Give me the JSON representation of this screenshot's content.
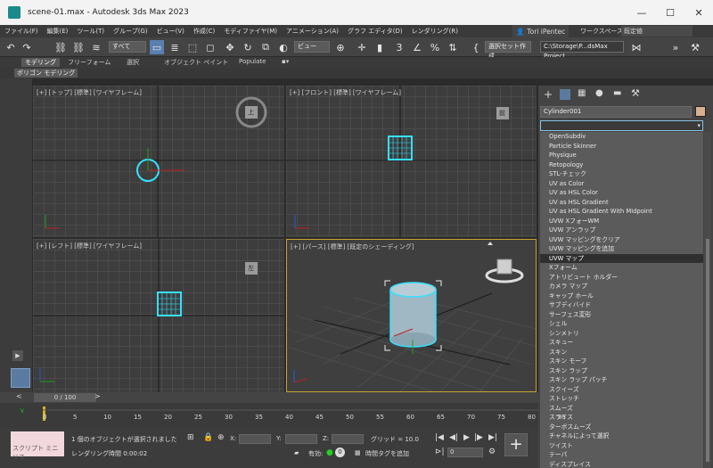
{
  "window": {
    "title": "scene-01.max - Autodesk 3ds Max 2023",
    "minimize_icon": "—",
    "maximize_icon": "☐",
    "close_icon": "✕"
  },
  "menu": {
    "items": [
      "ファイル(F)",
      "編集(E)",
      "ツール(T)",
      "グループ(G)",
      "ビュー(V)",
      "作成(C)",
      "モディファイヤ(M)",
      "アニメーション(A)",
      "グラフ エディタ(D)",
      "レンダリング(R)"
    ],
    "user": "Tori iPentec",
    "workspace_label": "ワークスペース:",
    "workspace_value": "既定値"
  },
  "toolbar": {
    "selection_filter": "すべて",
    "ref_coord": "ビュー",
    "named_selection": "選択セット作成",
    "project_path": "C:\\Storage\\P...dsMax Project"
  },
  "ribbon": {
    "tabs": [
      "モデリング",
      "フリーフォーム",
      "選択",
      "オブジェクト ペイント",
      "Populate"
    ],
    "sub": "ポリゴン モデリング"
  },
  "viewports": {
    "top": "[+] [トップ] [標準] [ワイヤフレーム]",
    "front": "[+] [フロント] [標準] [ワイヤフレーム]",
    "left": "[+] [レフト] [標準] [ワイヤフレーム]",
    "persp": "[+] [パース] [標準] [既定のシェーディング]",
    "cube_top": "上",
    "cube_front": "前",
    "cube_left": "左"
  },
  "command_panel": {
    "object_name": "Cylinder001",
    "object_color": "#d8b08e",
    "modifiers": [
      "OpenSubdiv",
      "Particle Skinner",
      "Physique",
      "Retopology",
      "STL-チェック",
      "UV as Color",
      "UV as HSL Color",
      "UV as HSL Gradient",
      "UV as HSL Gradient With Midpoint",
      "UVW XフォーWM",
      "UVW アンラップ",
      "UVW マッピングをクリア",
      "UVW マッピングを追加",
      "UVW マップ",
      "Xフォーム",
      "アトリビュート ホルダー",
      "カメラ マップ",
      "キャップ ホール",
      "サブディバイド",
      "サーフェス変形",
      "シェル",
      "シンメトリ",
      "スキュー",
      "スキン",
      "スキン モーフ",
      "スキン ラップ",
      "スキン ラップ パッチ",
      "スクイーズ",
      "ストレッチ",
      "スムーズ",
      "スライス",
      "ターボスムーズ",
      "チャネルによって選択",
      "ツイスト",
      "テーパ",
      "ディスプレイス"
    ],
    "selected_index": 13
  },
  "timeline": {
    "frame": "0 / 100",
    "ticks": [
      "0",
      "5",
      "10",
      "15",
      "20",
      "25",
      "30",
      "35",
      "40",
      "45",
      "50",
      "55",
      "60",
      "65",
      "70",
      "75",
      "80",
      "85"
    ]
  },
  "status": {
    "script_label": "スクリプト ミニ リス",
    "selection": "1 個のオブジェクトが選択されました",
    "render_time": "レンダリング時間 0:00:02",
    "x_label": "X:",
    "y_label": "Y:",
    "z_label": "Z:",
    "grid": "グリッド = 10.0",
    "enable_label": "有効:",
    "add_tag": "時間タグを追加",
    "frame_value": "0"
  }
}
